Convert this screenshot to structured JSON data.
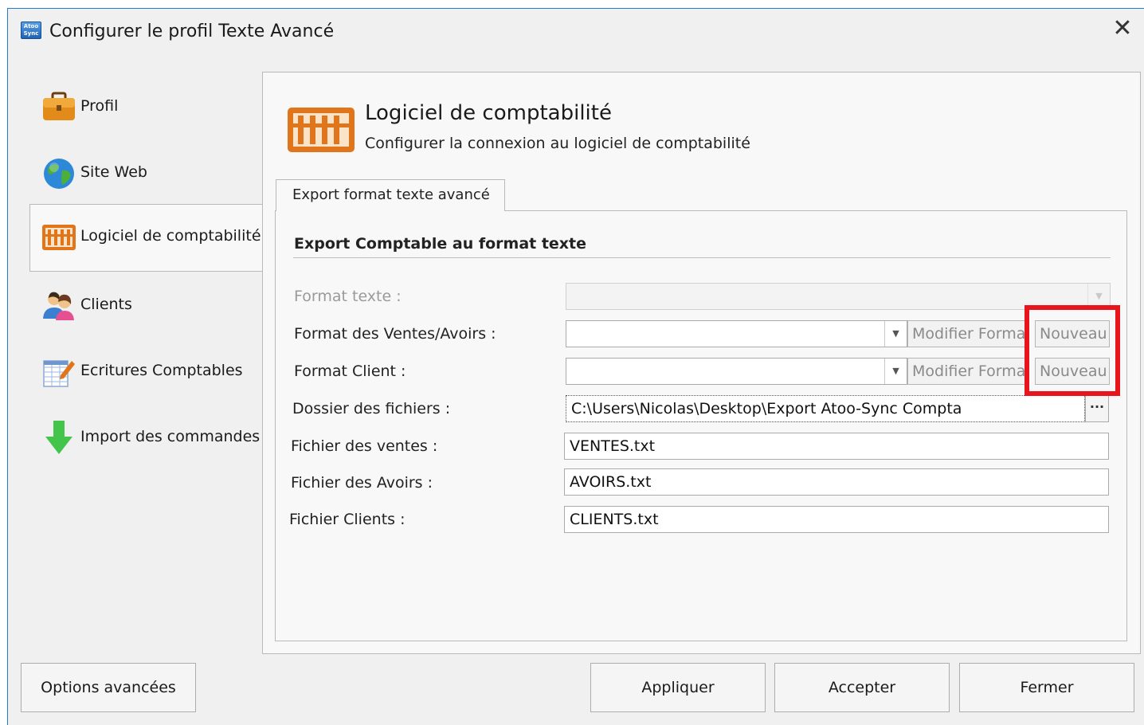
{
  "window": {
    "title": "Configurer le profil Texte Avancé",
    "app_icon_text": "Atoo Sync",
    "close_glyph": "✕"
  },
  "sidebar": {
    "items": [
      {
        "label": "Profil",
        "icon": "briefcase-icon"
      },
      {
        "label": "Site Web",
        "icon": "globe-icon"
      },
      {
        "label": "Logiciel de comptabilité",
        "icon": "abacus-icon",
        "active": true
      },
      {
        "label": "Clients",
        "icon": "users-icon"
      },
      {
        "label": "Ecritures Comptables",
        "icon": "ledger-edit-icon"
      },
      {
        "label": "Import des commandes",
        "icon": "arrow-down-icon"
      }
    ]
  },
  "header": {
    "title": "Logiciel de comptabilité",
    "subtitle": "Configurer la connexion au logiciel de comptabilité",
    "icon": "abacus-icon"
  },
  "tab": {
    "label": "Export format texte avancé"
  },
  "group": {
    "title": "Export Comptable au format texte"
  },
  "form": {
    "format_texte_label": "Format texte :",
    "format_texte_value": "",
    "ventes_label": "Format des Ventes/Avoirs :",
    "ventes_value": "",
    "client_label": "Format Client :",
    "client_value": "",
    "modifier_label": "Modifier Format",
    "nouveau_label": "Nouveau",
    "dossier_label": "Dossier des fichiers :",
    "dossier_value": "C:\\Users\\Nicolas\\Desktop\\Export Atoo-Sync Compta",
    "browse_label": "···",
    "fichier_ventes_label": "Fichier des ventes :",
    "fichier_ventes_value": "VENTES.txt",
    "fichier_avoirs_label": "Fichier des Avoirs :",
    "fichier_avoirs_value": "AVOIRS.txt",
    "fichier_clients_label": "Fichier Clients :",
    "fichier_clients_value": "CLIENTS.txt"
  },
  "buttons": {
    "options": "Options avancées",
    "appliquer": "Appliquer",
    "accepter": "Accepter",
    "fermer": "Fermer"
  },
  "colors": {
    "highlight": "#e8161c",
    "accent_border": "#1e7ad3"
  }
}
